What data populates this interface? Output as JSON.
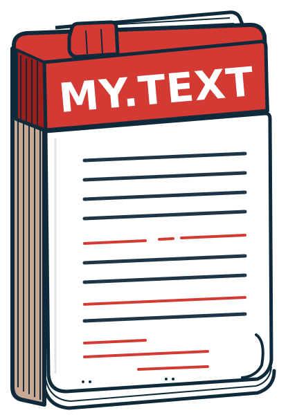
{
  "icon": {
    "name": "notepad-icon",
    "label": "MY.TEXT",
    "colors": {
      "header_red": "#d43a34",
      "header_red_dark": "#9f1e1b",
      "outline": "#0f2a3a",
      "paper": "#ffffff",
      "page_edge": "#f2efe8",
      "spine": "#c9a894",
      "text_line_dark": "#1e3646",
      "text_line_red": "#d43a34"
    }
  }
}
